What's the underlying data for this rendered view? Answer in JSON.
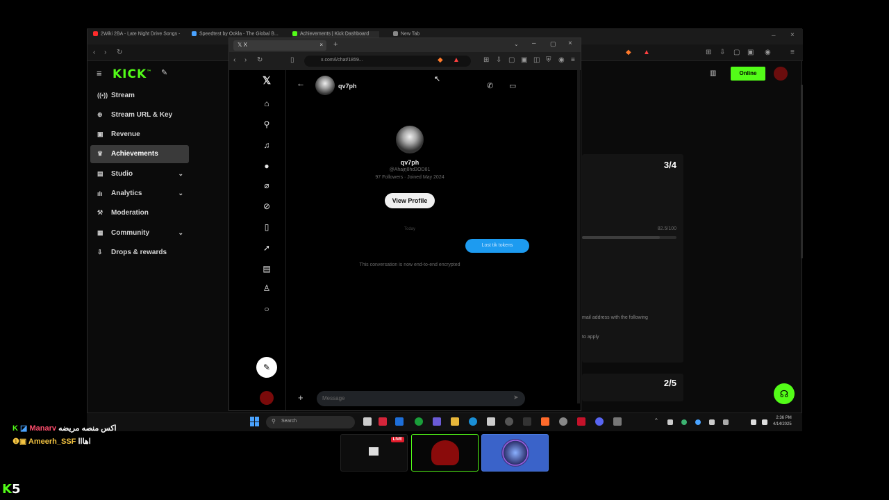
{
  "back_browser": {
    "tabs": [
      {
        "label": "2Wiki 2BA - Late Night Drive Songs -",
        "color": "#ff2b2b"
      },
      {
        "label": "Speedtest by Ookla - The Global B...",
        "color": "#4aa3ff"
      },
      {
        "label": "Achievements | Kick Dashboard",
        "color": "#53fc18"
      },
      {
        "label": "New Tab",
        "color": "#888888"
      }
    ],
    "accent": "#53fc18",
    "online_label": "Online"
  },
  "kick": {
    "logo": "KICK",
    "logo_sup": "™",
    "menu": [
      {
        "label": "Stream",
        "icon": "((•))",
        "chevron": false,
        "active": false
      },
      {
        "label": "Stream URL & Key",
        "icon": "⊕",
        "chevron": false,
        "active": false
      },
      {
        "label": "Revenue",
        "icon": "▣",
        "chevron": false,
        "active": false
      },
      {
        "label": "Achievements",
        "icon": "♛",
        "chevron": false,
        "active": true
      },
      {
        "label": "Studio",
        "icon": "▤",
        "chevron": true,
        "active": false
      },
      {
        "label": "Analytics",
        "icon": "ılı",
        "chevron": true,
        "active": false
      },
      {
        "label": "Moderation",
        "icon": "⚒",
        "chevron": false,
        "active": false
      },
      {
        "label": "Community",
        "icon": "▦",
        "chevron": true,
        "active": false
      },
      {
        "label": "Drops & rewards",
        "icon": "⇩",
        "chevron": false,
        "active": false
      }
    ]
  },
  "achievements_panel": {
    "card1_count": "3/4",
    "progress_text": "82.5/100",
    "progress_fraction": 0.82,
    "email_text": "mail address with the following",
    "apply_text": "to apply",
    "card2_count": "2/5"
  },
  "front_browser": {
    "tab_label": "X",
    "url": "x.com/i/chat/1859...",
    "chat": {
      "username": "qv7ph",
      "handle": "@Ahajrj8hd3OD81",
      "stats": "97 Followers · Joined May 2024",
      "view_profile": "View Profile",
      "day_divider": "Today",
      "message": "Lost tik tokens",
      "encrypted_note": "This conversation is now end-to-end encrypted",
      "input_placeholder": "Message"
    }
  },
  "taskbar": {
    "search_placeholder": "Search",
    "time": "2:36 PM",
    "date": "4/14/2025"
  },
  "overlay": {
    "chat_lines": [
      {
        "name": "Manarv",
        "name_color": "#ff4d6d",
        "message": "اكس منصه مريضه"
      },
      {
        "name": "Ameerh_SSF",
        "name_color": "#f5c542",
        "message": "اهااا"
      }
    ],
    "live_badge": "LIVE",
    "kick_count": "5"
  }
}
